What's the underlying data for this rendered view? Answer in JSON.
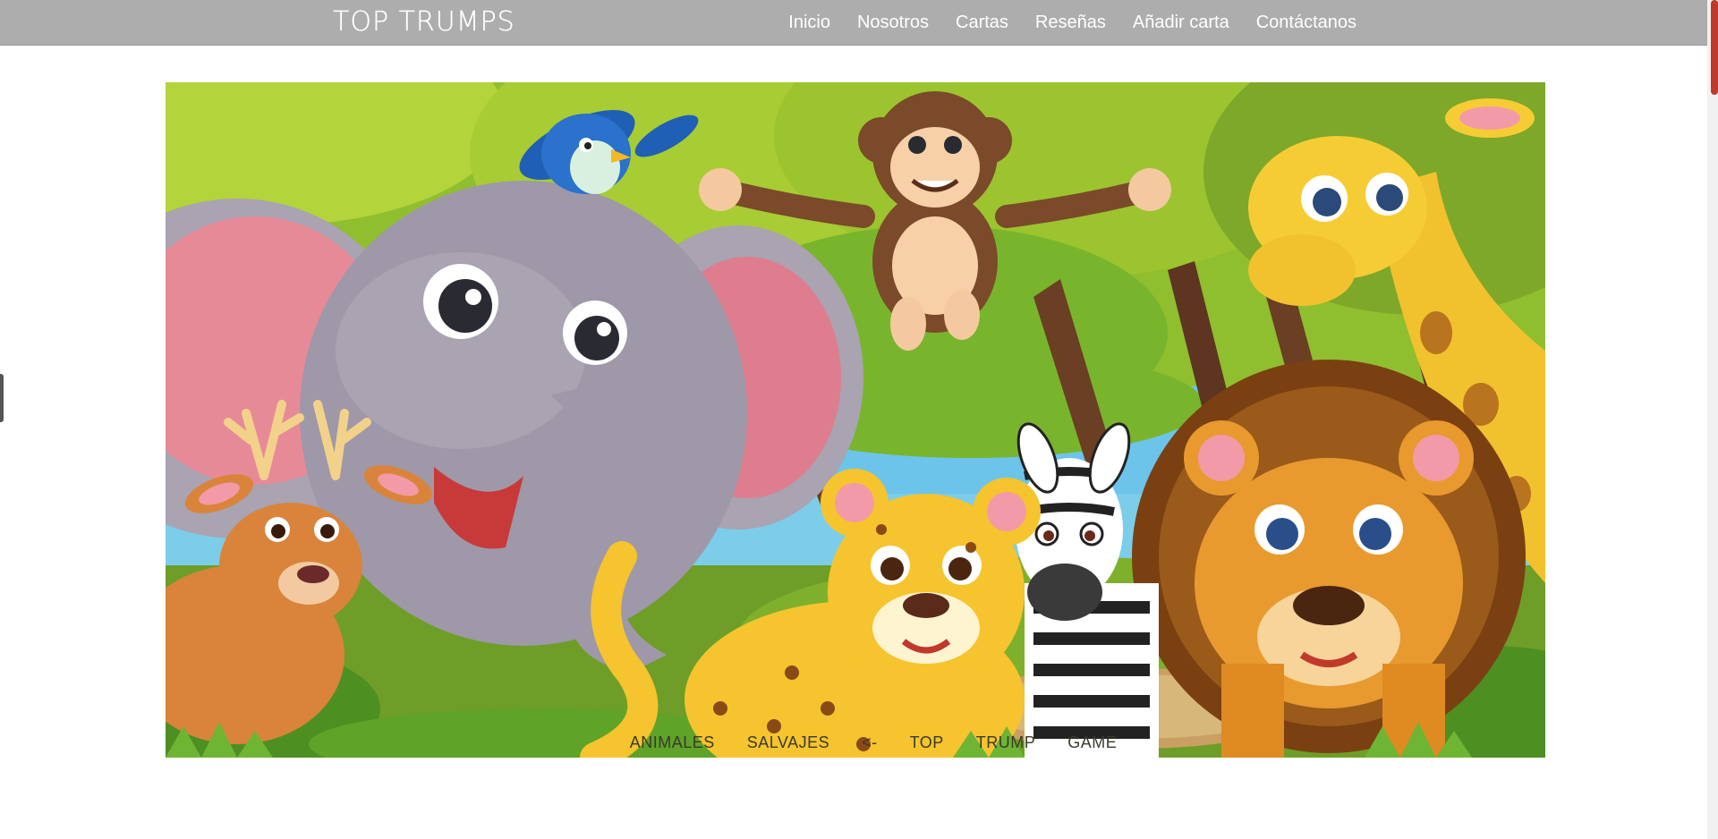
{
  "navbar": {
    "brand": "TOP TRUMPS",
    "links": [
      "Inicio",
      "Nosotros",
      "Cartas",
      "Reseñas",
      "Añadir carta",
      "Contáctanos"
    ]
  },
  "carousel": {
    "caption_words": [
      "ANIMALES",
      "SALVAJES",
      "<-",
      "TOP",
      "TRUMP",
      "GAME"
    ]
  },
  "colors": {
    "navbar_bg": "#adadad",
    "scroll_thumb": "#c0392b"
  }
}
